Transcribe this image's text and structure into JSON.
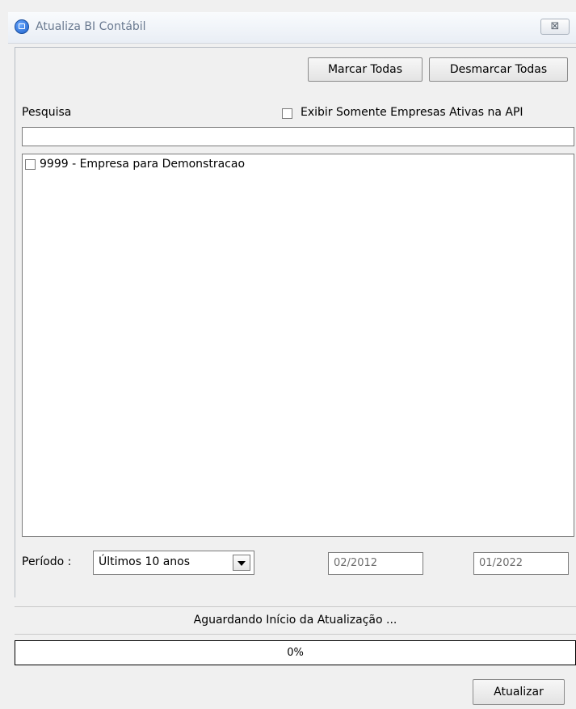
{
  "window": {
    "title": "Atualiza BI Contábil",
    "close_glyph": "⊠"
  },
  "toolbar": {
    "mark_all_label": "Marcar Todas",
    "unmark_all_label": "Desmarcar Todas"
  },
  "search": {
    "label": "Pesquisa",
    "value": "",
    "placeholder": ""
  },
  "filter": {
    "active_only_label": "Exibir Somente Empresas Ativas na API",
    "checked": false
  },
  "companies": [
    {
      "label": "9999 - Empresa para Demonstracao",
      "checked": false
    }
  ],
  "period": {
    "label": "Período :",
    "selected": "Últimos 10 anos",
    "start": "02/2012",
    "end": "01/2022"
  },
  "status": {
    "text": "Aguardando Início da Atualização ..."
  },
  "progress": {
    "label": "0%",
    "value": 0
  },
  "actions": {
    "update_label": "Atualizar"
  },
  "colors": {
    "progress_fill": "#3a8df5",
    "title_text": "#6a7a90"
  },
  "icons": {
    "app": "app-window-icon",
    "close": "close-icon",
    "dropdown": "chevron-down-icon"
  }
}
